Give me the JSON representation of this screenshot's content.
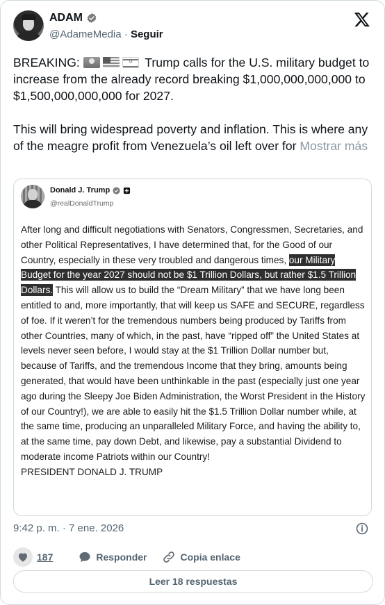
{
  "author": {
    "name": "ADAM",
    "handle": "@AdameMedia",
    "separator": "·",
    "follow_label": "Seguir"
  },
  "tweet": {
    "line1_prefix": "BREAKING:",
    "flags": [
      "light-icon",
      "us-flag-icon",
      "israel-flag-icon"
    ],
    "paragraph1_rest": "Trump calls for the U.S. military budget to increase from the already record breaking $1,000,000,000,000 to $1,500,000,000,000 for 2027.",
    "paragraph2": "This will bring widespread poverty and inflation. This is where any of the meagre profit from Venezuela’s oil left over for",
    "show_more": "Mostrar más"
  },
  "quoted": {
    "name": "Donald J. Trump",
    "handle": "@realDonaldTrump",
    "body_before": "After long and difficult negotiations with Senators, Congressmen, Secretaries, and other Political Representatives, I have determined that, for the Good of our Country, especially in these very troubled and dangerous times,",
    "body_highlight": "our Military Budget for the year 2027 should not be $1 Trillion Dollars, but rather $1.5 Trillion Dollars.",
    "body_after": "This will allow us to build the “Dream Military” that we have long been entitled to and, more importantly, that will keep us SAFE and SECURE, regardless of foe. If it weren’t for the tremendous numbers being produced by Tariffs from other Countries, many of which, in the past, have “ripped off” the United States at levels never seen before, I would stay at the $1 Trillion Dollar number but, because of Tariffs, and the tremendous Income that they bring, amounts being generated, that would have been unthinkable in the past (especially just one year ago during the Sleepy Joe Biden Administration, the Worst President in the History of our Country!), we are able to easily hit the $1.5 Trillion Dollar number while, at the same time, producing an unparalleled Military Force, and having the ability to, at the same time, pay down Debt, and likewise, pay a substantial Dividend to moderate income Patriots within our Country!",
    "signature": "PRESIDENT DONALD J. TRUMP"
  },
  "meta": {
    "timestamp": "9:42 p. m. · 7 ene. 2026"
  },
  "actions": {
    "like_count": "187",
    "reply_label": "Responder",
    "copy_label": "Copia enlace"
  },
  "read_replies": "Leer 18 respuestas",
  "colors": {
    "text": "#0f1419",
    "muted": "#536471",
    "border": "#cfd9de",
    "highlight_bg": "#2f2f2f"
  }
}
